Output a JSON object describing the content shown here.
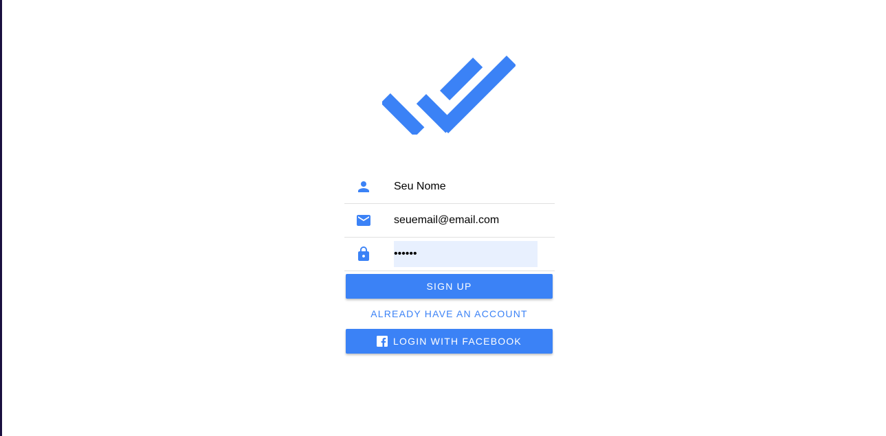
{
  "colors": {
    "accent": "#3b82f6",
    "autofill_bg": "#e8f0fe",
    "divider": "#e0e0e0"
  },
  "logo": {
    "icon": "double-check-icon"
  },
  "form": {
    "name": {
      "icon": "person-icon",
      "value": "Seu Nome"
    },
    "email": {
      "icon": "mail-icon",
      "value": "seuemail@email.com"
    },
    "password": {
      "icon": "lock-icon",
      "value": "123456"
    }
  },
  "actions": {
    "signup_label": "Sign up",
    "have_account_label": "Already have an account",
    "facebook_label": "Login with Facebook",
    "facebook_icon": "facebook-icon"
  }
}
